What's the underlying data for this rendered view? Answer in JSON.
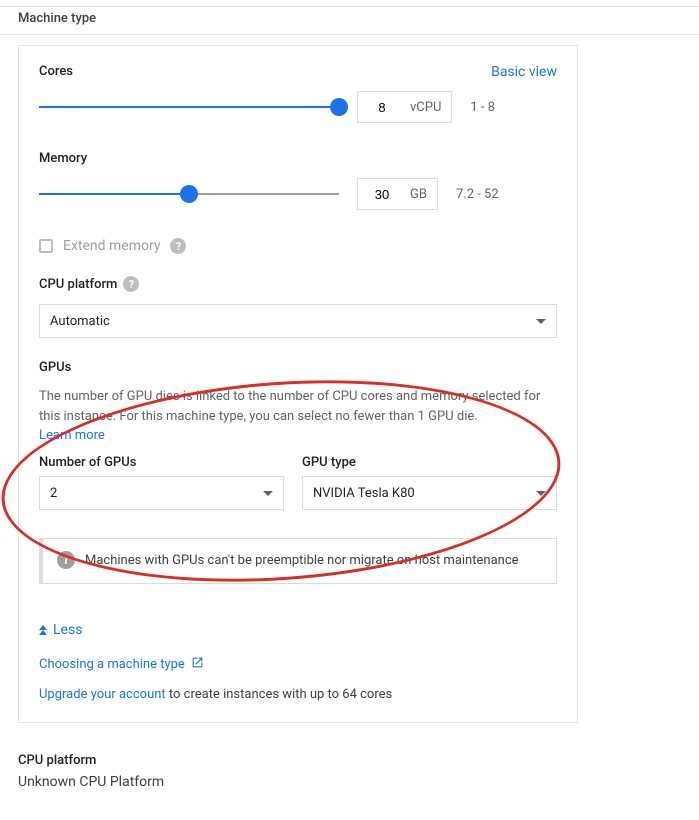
{
  "section_title": "Machine type",
  "basic_view_link": "Basic view",
  "cores": {
    "label": "Cores",
    "value": "8",
    "unit": "vCPU",
    "range": "1 - 8",
    "fill_pct": 100
  },
  "memory": {
    "label": "Memory",
    "value": "30",
    "unit": "GB",
    "range": "7.2 - 52",
    "fill_pct": 50
  },
  "extend_memory": {
    "label": "Extend memory"
  },
  "cpu_platform": {
    "label": "CPU platform",
    "value": "Automatic"
  },
  "gpus": {
    "label": "GPUs",
    "desc": "The number of GPU dies is linked to the number of CPU cores and memory selected for this instance. For this machine type, you can select no fewer than 1 GPU die.",
    "learn_more": "Learn more",
    "num_label": "Number of GPUs",
    "num_value": "2",
    "type_label": "GPU type",
    "type_value": "NVIDIA Tesla K80"
  },
  "info_text": "Machines with GPUs can't be preemptible nor migrate on host maintenance",
  "less_label": "Less",
  "choosing_link": "Choosing a machine type",
  "upgrade_link": "Upgrade your account",
  "upgrade_suffix": " to create instances with up to 64 cores",
  "bottom": {
    "label": "CPU platform",
    "value": "Unknown CPU Platform"
  }
}
